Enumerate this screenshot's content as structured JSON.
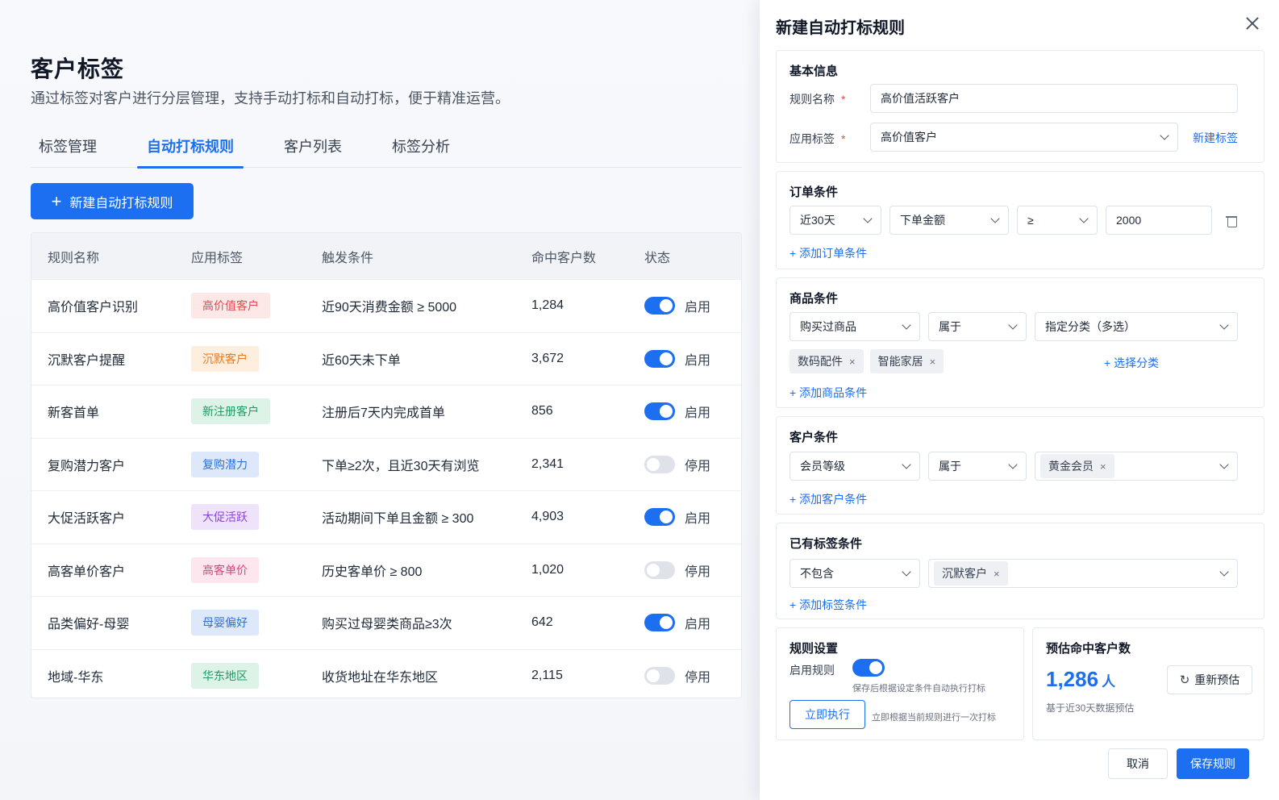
{
  "page": {
    "title": "客户标签",
    "description": "通过标签对客户进行分层管理，支持手动打标和自动打标，便于精准运营。",
    "tabs": [
      "标签管理",
      "自动打标规则",
      "客户列表",
      "标签分析"
    ],
    "new_button": "新建自动打标规则"
  },
  "colors": {
    "primary": "#1d6ff2",
    "danger": "#e5484d"
  },
  "table": {
    "headers": [
      "规则名称",
      "应用标签",
      "触发条件",
      "命中客户数",
      "状态"
    ],
    "rows": [
      {
        "name": "高价值客户识别",
        "tag": "高价值客户",
        "tag_color": "#e5484d",
        "tag_bg": "#fde8e8",
        "condition": "近90天消费金额 ≥ 5000",
        "count": "1,284",
        "enabled": true,
        "status": "启用"
      },
      {
        "name": "沉默客户提醒",
        "tag": "沉默客户",
        "tag_color": "#e8791f",
        "tag_bg": "#fdeedd",
        "condition": "近60天未下单",
        "count": "3,672",
        "enabled": true,
        "status": "启用"
      },
      {
        "name": "新客首单",
        "tag": "新注册客户",
        "tag_color": "#1f9a62",
        "tag_bg": "#ddf3e8",
        "condition": "注册后7天内完成首单",
        "count": "856",
        "enabled": true,
        "status": "启用"
      },
      {
        "name": "复购潜力客户",
        "tag": "复购潜力",
        "tag_color": "#2f6fd8",
        "tag_bg": "#dde9fb",
        "condition": "下单≥2次，且近30天有浏览",
        "count": "2,341",
        "enabled": false,
        "status": "停用"
      },
      {
        "name": "大促活跃客户",
        "tag": "大促活跃",
        "tag_color": "#8a45d6",
        "tag_bg": "#efe3fb",
        "condition": "活动期间下单且金额 ≥ 300",
        "count": "4,903",
        "enabled": true,
        "status": "启用"
      },
      {
        "name": "高客单价客户",
        "tag": "高客单价",
        "tag_color": "#d9437a",
        "tag_bg": "#fde6ee",
        "condition": "历史客单价 ≥ 800",
        "count": "1,020",
        "enabled": false,
        "status": "停用"
      },
      {
        "name": "品类偏好-母婴",
        "tag": "母婴偏好",
        "tag_color": "#2f6fd8",
        "tag_bg": "#dde9fb",
        "condition": "购买过母婴类商品≥3次",
        "count": "642",
        "enabled": true,
        "status": "启用"
      },
      {
        "name": "地域-华东",
        "tag": "华东地区",
        "tag_color": "#1f9a62",
        "tag_bg": "#ddf3e8",
        "condition": "收货地址在华东地区",
        "count": "2,115",
        "enabled": false,
        "status": "停用"
      }
    ]
  },
  "drawer": {
    "title": "新建自动打标规则",
    "basic": {
      "title": "基本信息",
      "name_label": "规则名称",
      "name_value": "高价值活跃客户",
      "tag_label": "应用标签",
      "tag_value": "高价值客户",
      "new_tag_link": "新建标签",
      "required_mark": "*"
    },
    "order": {
      "title": "订单条件",
      "period": "近30天",
      "metric": "下单金额",
      "operator": "≥",
      "value": "2000",
      "add_link": "+ 添加订单条件"
    },
    "product": {
      "title": "商品条件",
      "field": "购买过商品",
      "operator": "属于",
      "scope": "指定分类（多选）",
      "chips": [
        "数码配件",
        "智能家居"
      ],
      "choose_link": "+ 选择分类",
      "add_link": "+ 添加商品条件"
    },
    "customer": {
      "title": "客户条件",
      "field": "会员等级",
      "operator": "属于",
      "chip": "黄金会员",
      "add_link": "+ 添加客户条件"
    },
    "existing_tag": {
      "title": "已有标签条件",
      "operator": "不包含",
      "chip": "沉默客户",
      "add_link": "+ 添加标签条件"
    },
    "settings": {
      "title": "规则设置",
      "enable_label": "启用规则",
      "enable_hint": "保存后根据设定条件自动执行打标",
      "run_button": "立即执行",
      "run_hint": "立即根据当前规则进行一次打标"
    },
    "estimate": {
      "title": "预估命中客户数",
      "count": "1,286",
      "unit": "人",
      "refresh_button": "重新预估",
      "basis": "基于近30天数据预估"
    },
    "cancel_button": "取消",
    "save_button": "保存规则",
    "chip_close": "×"
  }
}
